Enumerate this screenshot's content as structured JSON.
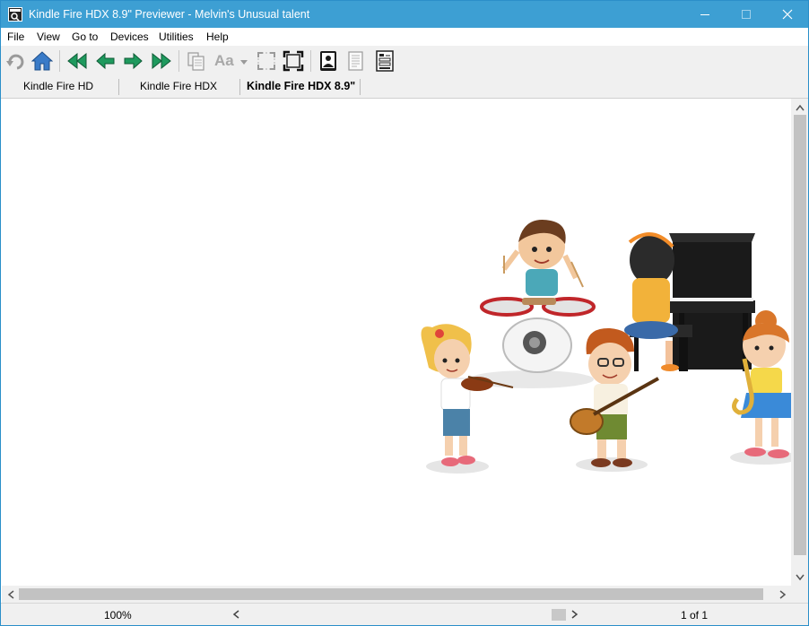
{
  "window": {
    "title": "Kindle Fire HDX 8.9\" Previewer - Melvin's Unusual talent"
  },
  "menu": [
    "File",
    "View",
    "Go to",
    "Devices",
    "Utilities",
    "Help"
  ],
  "toolbar": {
    "icons": [
      "undo-icon",
      "home-icon",
      "first-page-icon",
      "previous-page-icon",
      "next-page-icon",
      "last-page-icon",
      "copy-icon",
      "font-size-icon",
      "fit-width-icon",
      "full-screen-icon",
      "portrait-icon",
      "page-icon",
      "settings-panel-icon"
    ],
    "font_label": "Aa"
  },
  "tabs": [
    {
      "label": "Kindle Fire HD",
      "active": false
    },
    {
      "label": "Kindle Fire HDX",
      "active": false
    },
    {
      "label": "Kindle Fire HDX 8.9\"",
      "active": true
    }
  ],
  "content": {
    "illustration": "children-playing-music-illustration"
  },
  "status": {
    "zoom": "100%",
    "page": "1 of 1"
  },
  "colors": {
    "titlebar": "#3d9fd3",
    "toolbar_green": "#1f9a5e",
    "scroll_thumb": "#c2c2c2"
  }
}
